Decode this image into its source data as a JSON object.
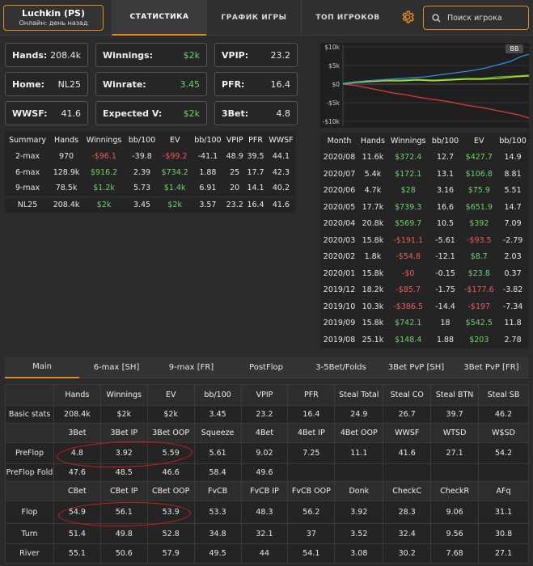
{
  "header": {
    "player_name": "Luchkin (PS)",
    "player_status": "Онлайн: день назад",
    "tabs": [
      "СТАТИСТИКА",
      "ГРАФИК ИГРЫ",
      "ТОП ИГРОКОВ"
    ],
    "active_tab": 0,
    "search_placeholder": "Поиск игрока"
  },
  "stats": {
    "hands_label": "Hands:",
    "hands": "208.4k",
    "winnings_label": "Winnings:",
    "winnings": "$2k",
    "vpip_label": "VPIP:",
    "vpip": "23.2",
    "home_label": "Home:",
    "home": "NL25",
    "winrate_label": "Winrate:",
    "winrate": "3.45",
    "pfr_label": "PFR:",
    "pfr": "16.4",
    "wwsf_label": "WWSF:",
    "wwsf": "41.6",
    "ev_label": "Expected V:",
    "ev": "$2k",
    "threebet_label": "3Bet:",
    "threebet": "4.8"
  },
  "summary": {
    "headers": [
      "Summary",
      "Hands",
      "Winnings",
      "bb/100",
      "EV",
      "bb/100",
      "VPIP",
      "PFR",
      "WWSF"
    ],
    "rows": [
      [
        "2-max",
        "970",
        "-$96.1",
        "-39.8",
        "-$99.2",
        "-41.1",
        "48.9",
        "39.5",
        "44.1"
      ],
      [
        "6-max",
        "128.9k",
        "$916.2",
        "2.39",
        "$734.2",
        "1.88",
        "25",
        "17.7",
        "42.3"
      ],
      [
        "9-max",
        "78.5k",
        "$1.2k",
        "5.73",
        "$1.4k",
        "6.91",
        "20",
        "14.1",
        "40.2"
      ],
      [
        "NL25",
        "208.4k",
        "$2k",
        "3.45",
        "$2k",
        "3.57",
        "23.2",
        "16.4",
        "41.6"
      ]
    ]
  },
  "graph": {
    "y_ticks": [
      "$10k",
      "$5k",
      "$0",
      "-$5k",
      "-$10k"
    ],
    "badge": "BB",
    "colors": {
      "winnings": "#2e8fe0",
      "ev": "#d8e020",
      "nonsd": "#e03a3a",
      "sd": "#40c040"
    }
  },
  "monthly": {
    "headers": [
      "Month",
      "Hands",
      "Winnings",
      "bb/100",
      "EV",
      "bb/100"
    ],
    "rows": [
      [
        "2020/08",
        "11.6k",
        "$372.4",
        "12.7",
        "$427.7",
        "14.9"
      ],
      [
        "2020/07",
        "5.4k",
        "$172.1",
        "13.1",
        "$106.8",
        "8.81"
      ],
      [
        "2020/06",
        "4.7k",
        "$28",
        "3.16",
        "$75.9",
        "5.51"
      ],
      [
        "2020/05",
        "17.7k",
        "$739.3",
        "16.6",
        "$651.9",
        "14.7"
      ],
      [
        "2020/04",
        "20.8k",
        "$569.7",
        "10.5",
        "$392",
        "7.09"
      ],
      [
        "2020/03",
        "15.8k",
        "-$191.1",
        "-5.61",
        "-$93.5",
        "-2.79"
      ],
      [
        "2020/02",
        "1.8k",
        "-$54.8",
        "-12.1",
        "$8.7",
        "2.03"
      ],
      [
        "2020/01",
        "15.8k",
        "-$0",
        "-0.15",
        "$23.8",
        "0.37"
      ],
      [
        "2019/12",
        "18.2k",
        "-$85.7",
        "-1.75",
        "-$177.6",
        "-3.82"
      ],
      [
        "2019/10",
        "10.3k",
        "-$386.5",
        "-14.4",
        "-$197",
        "-7.34"
      ],
      [
        "2019/09",
        "15.8k",
        "$742.1",
        "18",
        "$542.5",
        "11.8"
      ],
      [
        "2019/08",
        "25.1k",
        "$148.4",
        "1.88",
        "$203",
        "2.78"
      ]
    ]
  },
  "bottom_tabs": [
    "Main",
    "6-max [SH]",
    "9-max [FR]",
    "PostFlop",
    "3-5Bet/Folds",
    "3Bet PvP [SH]",
    "3Bet PvP [FR]"
  ],
  "main_table": {
    "sections": [
      {
        "header": [
          "",
          "Hands",
          "Winnings",
          "EV",
          "bb/100",
          "VPIP",
          "PFR",
          "Steal Total",
          "Steal CO",
          "Steal BTN",
          "Steal SB"
        ],
        "rows": [
          [
            "Basic stats",
            "208.4k",
            "$2k",
            "$2k",
            "3.45",
            "23.2",
            "16.4",
            "24.9",
            "26.7",
            "39.7",
            "46.2"
          ]
        ]
      },
      {
        "header": [
          "",
          "3Bet",
          "3Bet IP",
          "3Bet OOP",
          "Squeeze",
          "4Bet",
          "4Bet IP",
          "4Bet OOP",
          "WWSF",
          "WTSD",
          "W$SD"
        ],
        "rows": [
          [
            "PreFlop",
            "4.8",
            "3.92",
            "5.59",
            "5.61",
            "9.02",
            "7.25",
            "11.1",
            "41.6",
            "27.1",
            "54.2"
          ],
          [
            "PreFlop Fold",
            "47.6",
            "48.5",
            "46.6",
            "58.4",
            "49.6",
            "",
            "",
            "",
            "",
            ""
          ]
        ]
      },
      {
        "header": [
          "",
          "CBet",
          "CBet IP",
          "CBet OOP",
          "FvCB",
          "FvCB IP",
          "FvCB OOP",
          "Donk",
          "CheckC",
          "CheckR",
          "AFq"
        ],
        "rows": [
          [
            "Flop",
            "54.9",
            "56.1",
            "53.9",
            "53.3",
            "48.3",
            "56.2",
            "3.92",
            "28.3",
            "9.06",
            "31.1"
          ],
          [
            "Turn",
            "51.4",
            "49.8",
            "52.8",
            "34.8",
            "32.1",
            "37",
            "3.52",
            "32.4",
            "9.56",
            "30.8"
          ],
          [
            "River",
            "55.1",
            "50.6",
            "57.9",
            "49.5",
            "44",
            "54.1",
            "3.08",
            "30.2",
            "7.68",
            "27.1"
          ]
        ]
      }
    ]
  }
}
